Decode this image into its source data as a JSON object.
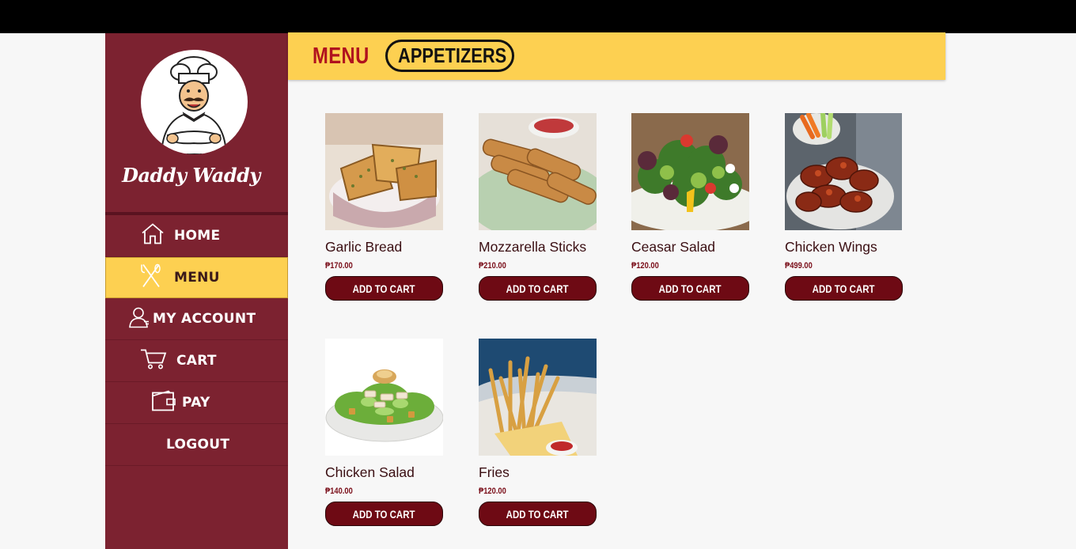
{
  "brand": {
    "name": "Daddy Waddy"
  },
  "nav": {
    "items": [
      {
        "label": "HOME",
        "icon": "home-icon"
      },
      {
        "label": "MENU",
        "icon": "utensils-icon",
        "active": true
      },
      {
        "label": "MY ACCOUNT",
        "icon": "user-icon"
      },
      {
        "label": "CART",
        "icon": "cart-icon"
      },
      {
        "label": "PAY",
        "icon": "wallet-icon"
      },
      {
        "label": "LOGOUT",
        "icon": ""
      }
    ]
  },
  "header": {
    "title": "MENU",
    "category": "APPETIZERS"
  },
  "products": [
    {
      "name": "Garlic Bread",
      "price": "₱170.00",
      "button": "ADD TO CART"
    },
    {
      "name": "Mozzarella Sticks",
      "price": "₱210.00",
      "button": "ADD TO CART"
    },
    {
      "name": "Ceasar Salad",
      "price": "₱120.00",
      "button": "ADD TO CART"
    },
    {
      "name": "Chicken Wings",
      "price": "₱499.00",
      "button": "ADD TO CART"
    },
    {
      "name": "Chicken Salad",
      "price": "₱140.00",
      "button": "ADD TO CART"
    },
    {
      "name": "Fries",
      "price": "₱120.00",
      "button": "ADD TO CART"
    }
  ],
  "colors": {
    "sidebar": "#7c2230",
    "accent": "#fdd051",
    "button": "#6e0a14",
    "title_red": "#b0121e"
  }
}
